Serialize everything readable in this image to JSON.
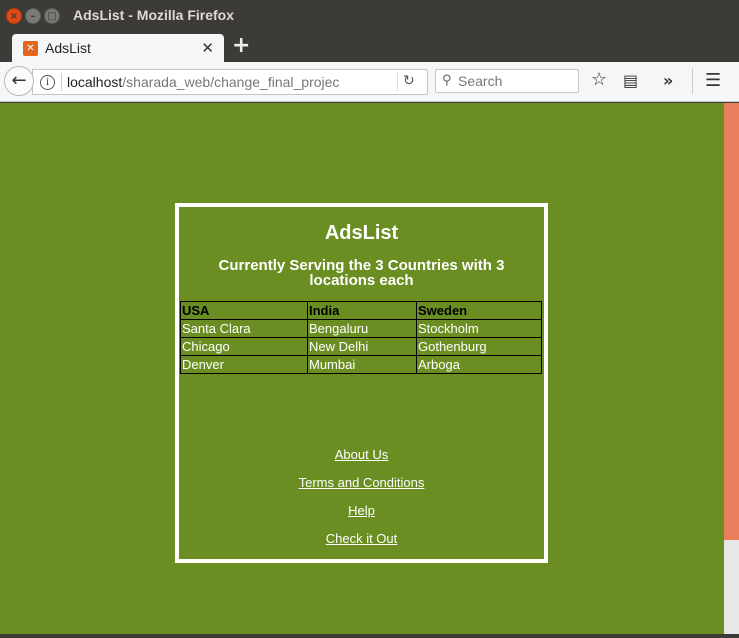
{
  "window": {
    "title": "AdsList - Mozilla Firefox",
    "close_glyph": "×",
    "min_glyph": "–",
    "max_glyph": "□"
  },
  "tab": {
    "title": "AdsList",
    "favicon_icon": "xampp-icon",
    "favicon_glyph": "✕",
    "close_glyph": "✕",
    "new_tab_glyph": "+"
  },
  "navbar": {
    "back_glyph": "←",
    "info_glyph": "i",
    "url_host": "localhost",
    "url_path": "/sharada_web/change_final_projec",
    "reload_glyph": "↻",
    "search_placeholder": "Search",
    "search_glyph": "⚲",
    "bookmark_glyph": "☆",
    "reader_glyph": "▤",
    "overflow_glyph": "»",
    "menu_glyph": "☰"
  },
  "page": {
    "title": "AdsList",
    "subtitle": "Currently Serving the 3 Countries with 3 locations each",
    "table": {
      "headers": [
        "USA",
        "India",
        "Sweden"
      ],
      "rows": [
        [
          "Santa Clara",
          "Bengaluru",
          "Stockholm"
        ],
        [
          "Chicago",
          "New Delhi",
          "Gothenburg"
        ],
        [
          "Denver",
          "Mumbai",
          "Arboga"
        ]
      ]
    },
    "links": [
      "About Us",
      "Terms and Conditions",
      "Help",
      "Check it Out"
    ]
  },
  "colors": {
    "page_background": "#6b8e23",
    "accent_scrollbar": "#e97e5a",
    "close_button": "#df4a16"
  }
}
